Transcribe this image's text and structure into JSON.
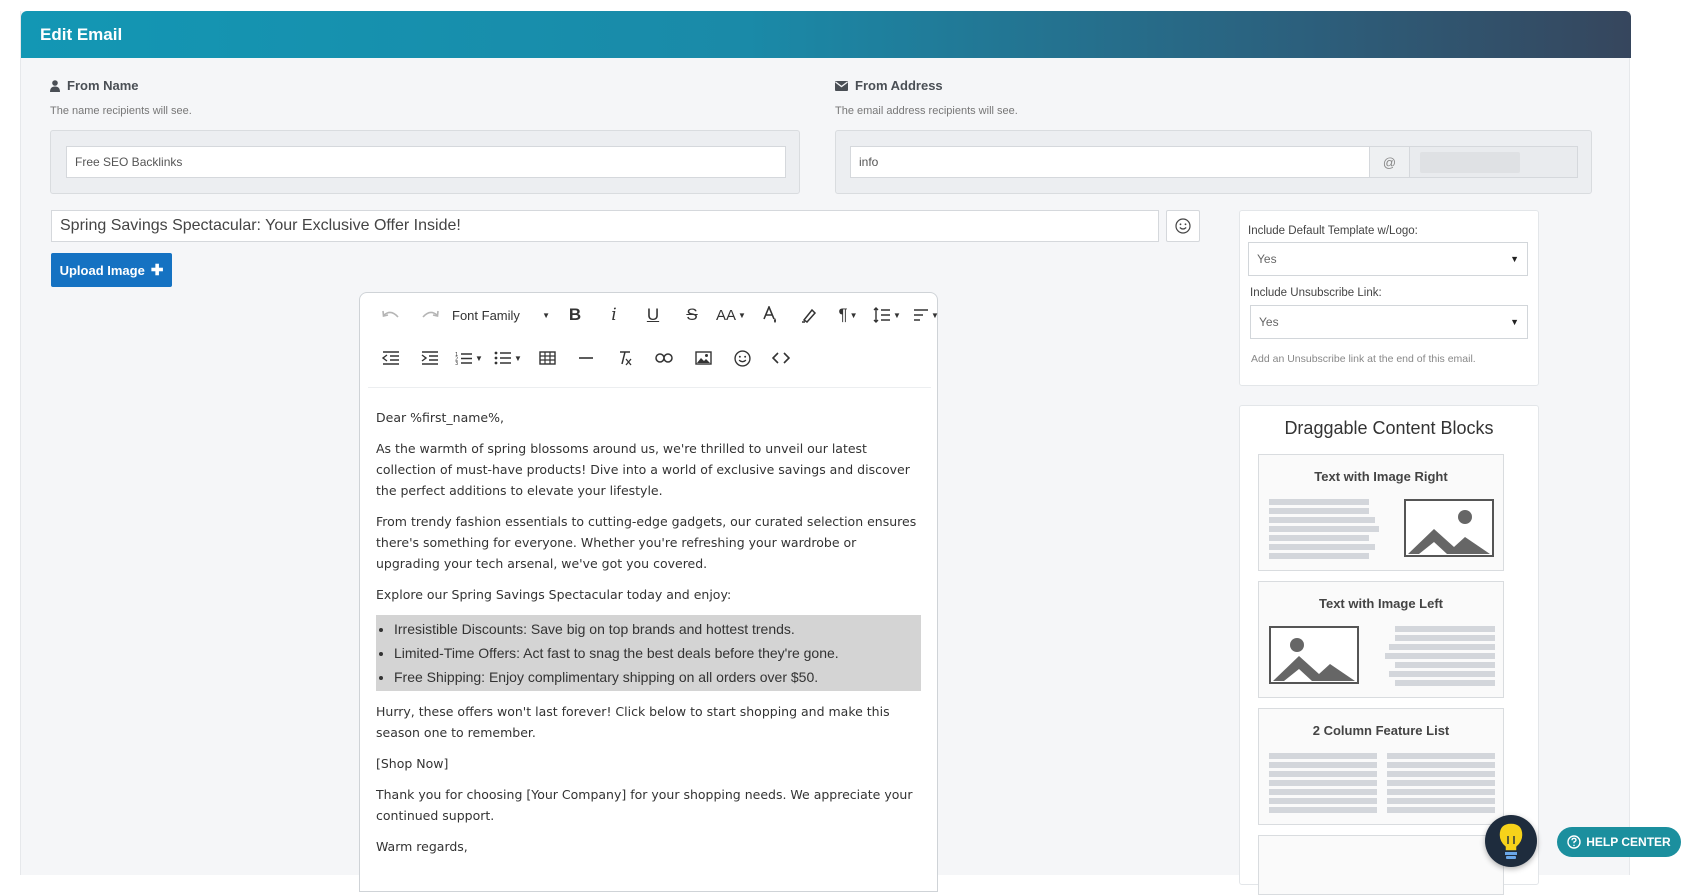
{
  "header": {
    "title": "Edit Email"
  },
  "from_name": {
    "label": "From Name",
    "help": "The name recipients will see.",
    "value": "Free SEO Backlinks"
  },
  "from_address": {
    "label": "From Address",
    "help": "The email address recipients will see.",
    "value": "info",
    "at_symbol": "@"
  },
  "subject": {
    "value": "Spring Savings Spectacular: Your Exclusive Offer Inside!"
  },
  "upload": {
    "label": "Upload Image"
  },
  "toolbar": {
    "font_family": "Font Family"
  },
  "email_body": {
    "greeting": "Dear %first_name%,",
    "p1": "As the warmth of spring blossoms around us, we're thrilled to unveil our latest collection of must-have products! Dive into a world of exclusive savings and discover the perfect additions to elevate your lifestyle.",
    "p2": "From trendy fashion essentials to cutting-edge gadgets, our curated selection ensures there's something for everyone. Whether you're refreshing your wardrobe or upgrading your tech arsenal, we've got you covered.",
    "p3": "Explore our Spring Savings Spectacular today and enjoy:",
    "bullets": [
      "Irresistible Discounts: Save big on top brands and hottest trends.",
      "Limited-Time Offers: Act fast to snag the best deals before they're gone.",
      "Free Shipping: Enjoy complimentary shipping on all orders over $50."
    ],
    "p4": "Hurry, these offers won't last forever! Click below to start shopping and make this season one to remember.",
    "p5": "[Shop Now]",
    "p6": "Thank you for choosing [Your Company] for your shopping needs. We appreciate your continued support.",
    "p7": "Warm regards,"
  },
  "settings": {
    "template_label": "Include Default Template w/Logo:",
    "template_value": "Yes",
    "unsub_label": "Include Unsubscribe Link:",
    "unsub_value": "Yes",
    "unsub_help": "Add an Unsubscribe link at the end of this email."
  },
  "blocks": {
    "title": "Draggable Content Blocks",
    "items": [
      {
        "title": "Text with Image Right"
      },
      {
        "title": "Text with Image Left"
      },
      {
        "title": "2 Column Feature List"
      }
    ]
  },
  "help_center": {
    "label": "HELP CENTER"
  },
  "colors": {
    "accent": "#1572c2",
    "header_start": "#1397b4",
    "header_end": "#36465d",
    "help": "#1b8f9e"
  }
}
